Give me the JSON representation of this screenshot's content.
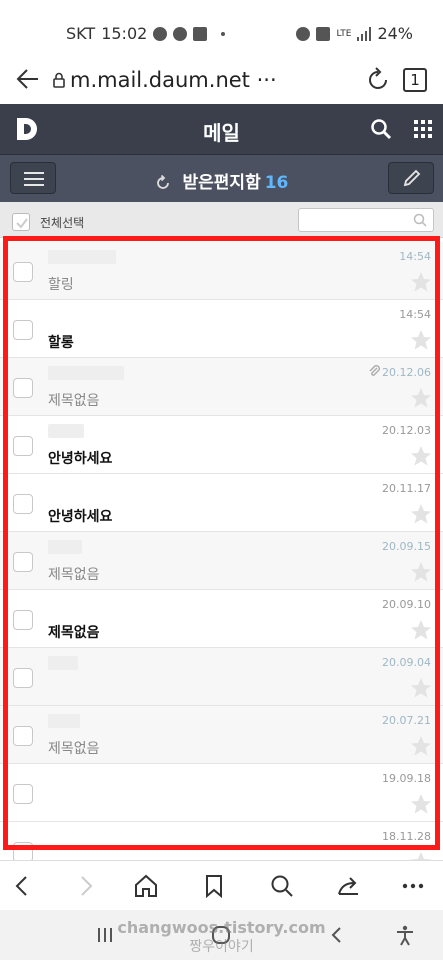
{
  "status": {
    "carrier": "SKT",
    "time": "15:02",
    "battery": "24%",
    "network": "LTE"
  },
  "browser": {
    "url": "m.mail.daum.net",
    "url_suffix": "···",
    "tab_count": "1"
  },
  "header": {
    "logo": "D",
    "title": "메일"
  },
  "mailbox": {
    "name": "받은편지함",
    "count": "16"
  },
  "toolbar": {
    "select_all_label": "전체선택",
    "search_placeholder": ""
  },
  "mails": [
    {
      "subject": "할링",
      "date": "14:54",
      "read": true,
      "attachment": false,
      "sender_w": 68
    },
    {
      "subject": "할롱",
      "date": "14:54",
      "read": false,
      "attachment": false,
      "sender_w": 0
    },
    {
      "subject": "제목없음",
      "date": "20.12.06",
      "read": true,
      "attachment": true,
      "sender_w": 76
    },
    {
      "subject": "안녕하세요",
      "date": "20.12.03",
      "read": false,
      "attachment": false,
      "sender_w": 36
    },
    {
      "subject": "안녕하세요",
      "date": "20.11.17",
      "read": false,
      "attachment": false,
      "sender_w": 0
    },
    {
      "subject": "제목없음",
      "date": "20.09.15",
      "read": true,
      "attachment": false,
      "sender_w": 34
    },
    {
      "subject": "제목없음",
      "date": "20.09.10",
      "read": false,
      "attachment": false,
      "sender_w": 0
    },
    {
      "subject": "",
      "date": "20.09.04",
      "read": true,
      "attachment": false,
      "sender_w": 30
    },
    {
      "subject": "제목없음",
      "date": "20.07.21",
      "read": true,
      "attachment": false,
      "sender_w": 32
    },
    {
      "subject": "",
      "date": "19.09.18",
      "read": false,
      "attachment": false,
      "sender_w": 0
    },
    {
      "subject": "",
      "date": "18.11.28",
      "read": false,
      "attachment": false,
      "sender_w": 0
    }
  ],
  "watermark": {
    "line1": "changwoos.tistory.com",
    "line2": "짱우이야기"
  },
  "colors": {
    "header_bg": "#3a3f4b",
    "subheader_bg": "#4b5160",
    "count_color": "#5fb8ff",
    "highlight_border": "#ff1a1a"
  }
}
